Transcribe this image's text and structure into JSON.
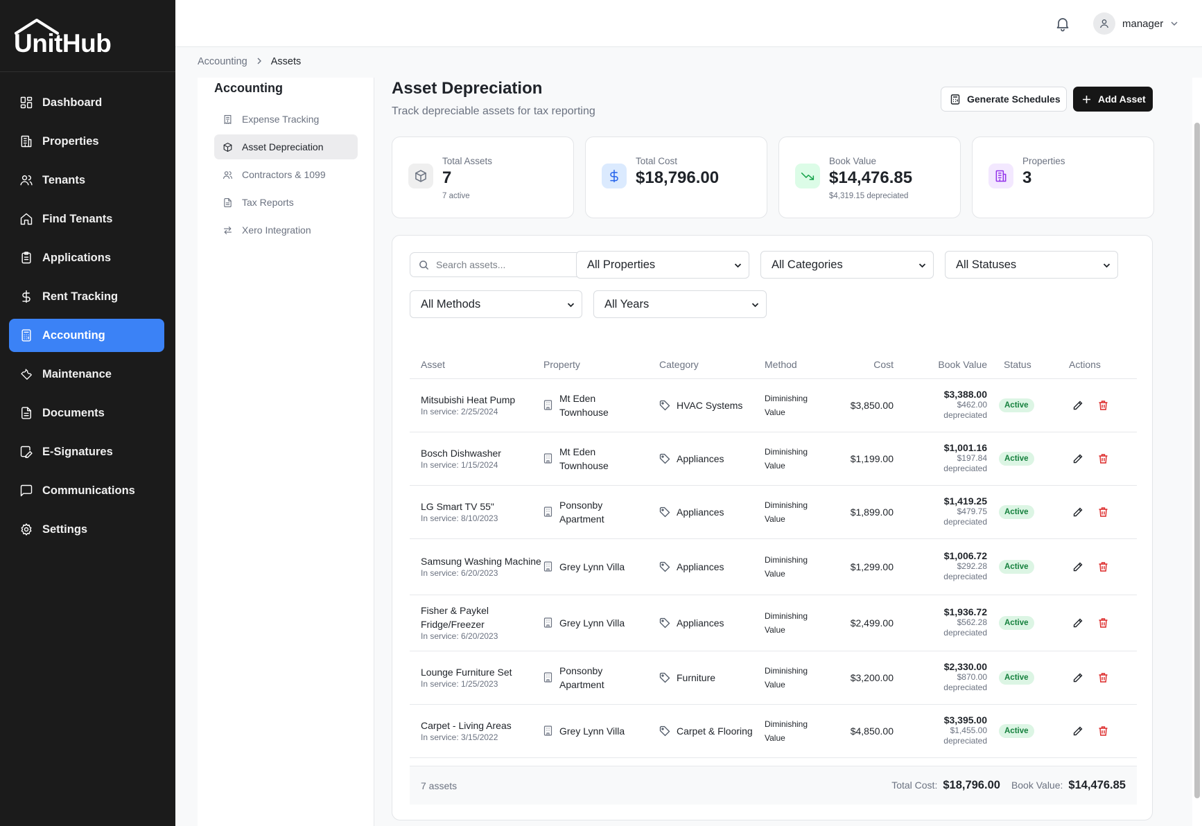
{
  "app": {
    "name": "UnitHub"
  },
  "sidebar": {
    "items": [
      {
        "label": "Dashboard",
        "icon": "dashboard-icon"
      },
      {
        "label": "Properties",
        "icon": "building-icon"
      },
      {
        "label": "Tenants",
        "icon": "users-icon"
      },
      {
        "label": "Find Tenants",
        "icon": "home-icon"
      },
      {
        "label": "Applications",
        "icon": "clipboard-icon"
      },
      {
        "label": "Rent Tracking",
        "icon": "dollar-icon"
      },
      {
        "label": "Accounting",
        "icon": "calculator-icon",
        "active": true
      },
      {
        "label": "Maintenance",
        "icon": "wrench-icon"
      },
      {
        "label": "Documents",
        "icon": "document-icon"
      },
      {
        "label": "E-Signatures",
        "icon": "signature-icon"
      },
      {
        "label": "Communications",
        "icon": "message-icon"
      },
      {
        "label": "Settings",
        "icon": "gear-icon"
      }
    ]
  },
  "header": {
    "user": "manager"
  },
  "breadcrumb": {
    "parent": "Accounting",
    "current": "Assets"
  },
  "subnav": {
    "title": "Accounting",
    "items": [
      {
        "label": "Expense Tracking",
        "icon": "receipt-icon"
      },
      {
        "label": "Asset Depreciation",
        "icon": "box-icon",
        "active": true
      },
      {
        "label": "Contractors & 1099",
        "icon": "users-icon"
      },
      {
        "label": "Tax Reports",
        "icon": "document-icon"
      },
      {
        "label": "Xero Integration",
        "icon": "arrows-icon"
      }
    ]
  },
  "page": {
    "title": "Asset Depreciation",
    "subtitle": "Track depreciable assets for tax reporting",
    "generate_label": "Generate Schedules",
    "add_label": "Add Asset"
  },
  "stats": [
    {
      "label": "Total Assets",
      "value": "7",
      "note": "7 active",
      "icon": "box-icon",
      "color": "#6b7280",
      "bg": "#efefef"
    },
    {
      "label": "Total Cost",
      "value": "$18,796.00",
      "note": "",
      "icon": "dollar-icon",
      "color": "#2563eb",
      "bg": "#dbeafe"
    },
    {
      "label": "Book Value",
      "value": "$14,476.85",
      "note": "$4,319.15 depreciated",
      "icon": "trending-down-icon",
      "color": "#16a34a",
      "bg": "#dcfce7"
    },
    {
      "label": "Properties",
      "value": "3",
      "note": "",
      "icon": "building-icon",
      "color": "#9333ea",
      "bg": "#f3e8ff"
    }
  ],
  "filters": {
    "search_placeholder": "Search assets...",
    "property": "All Properties",
    "category": "All Categories",
    "status": "All Statuses",
    "method": "All Methods",
    "year": "All Years"
  },
  "table": {
    "columns": [
      "Asset",
      "Property",
      "Category",
      "Method",
      "Cost",
      "Book Value",
      "Status",
      "Actions"
    ],
    "rows": [
      {
        "name": "Mitsubishi Heat Pump",
        "service": "In service: 2/25/2024",
        "property": "Mt Eden Townhouse",
        "category": "HVAC Systems",
        "method": "Diminishing Value",
        "cost": "$3,850.00",
        "book": "$3,388.00",
        "dep": "$462.00",
        "dep_label": "depreciated",
        "status": "Active"
      },
      {
        "name": "Bosch Dishwasher",
        "service": "In service: 1/15/2024",
        "property": "Mt Eden Townhouse",
        "category": "Appliances",
        "method": "Diminishing Value",
        "cost": "$1,199.00",
        "book": "$1,001.16",
        "dep": "$197.84",
        "dep_label": "depreciated",
        "status": "Active"
      },
      {
        "name": "LG Smart TV 55\"",
        "service": "In service: 8/10/2023",
        "property": "Ponsonby Apartment",
        "category": "Appliances",
        "method": "Diminishing Value",
        "cost": "$1,899.00",
        "book": "$1,419.25",
        "dep": "$479.75",
        "dep_label": "depreciated",
        "status": "Active"
      },
      {
        "name": "Samsung Washing Machine",
        "service": "In service: 6/20/2023",
        "property": "Grey Lynn Villa",
        "category": "Appliances",
        "method": "Diminishing Value",
        "cost": "$1,299.00",
        "book": "$1,006.72",
        "dep": "$292.28",
        "dep_label": "depreciated",
        "status": "Active"
      },
      {
        "name": "Fisher & Paykel Fridge/Freezer",
        "service": "In service: 6/20/2023",
        "property": "Grey Lynn Villa",
        "category": "Appliances",
        "method": "Diminishing Value",
        "cost": "$2,499.00",
        "book": "$1,936.72",
        "dep": "$562.28",
        "dep_label": "depreciated",
        "status": "Active"
      },
      {
        "name": "Lounge Furniture Set",
        "service": "In service: 1/25/2023",
        "property": "Ponsonby Apartment",
        "category": "Furniture",
        "method": "Diminishing Value",
        "cost": "$3,200.00",
        "book": "$2,330.00",
        "dep": "$870.00",
        "dep_label": "depreciated",
        "status": "Active"
      },
      {
        "name": "Carpet - Living Areas",
        "service": "In service: 3/15/2022",
        "property": "Grey Lynn Villa",
        "category": "Carpet & Flooring",
        "method": "Diminishing Value",
        "cost": "$4,850.00",
        "book": "$3,395.00",
        "dep": "$1,455.00",
        "dep_label": "depreciated",
        "status": "Active"
      }
    ],
    "footer": {
      "count": "7 assets",
      "cost_label": "Total Cost:",
      "cost": "$18,796.00",
      "book_label": "Book Value:",
      "book": "$14,476.85"
    }
  }
}
